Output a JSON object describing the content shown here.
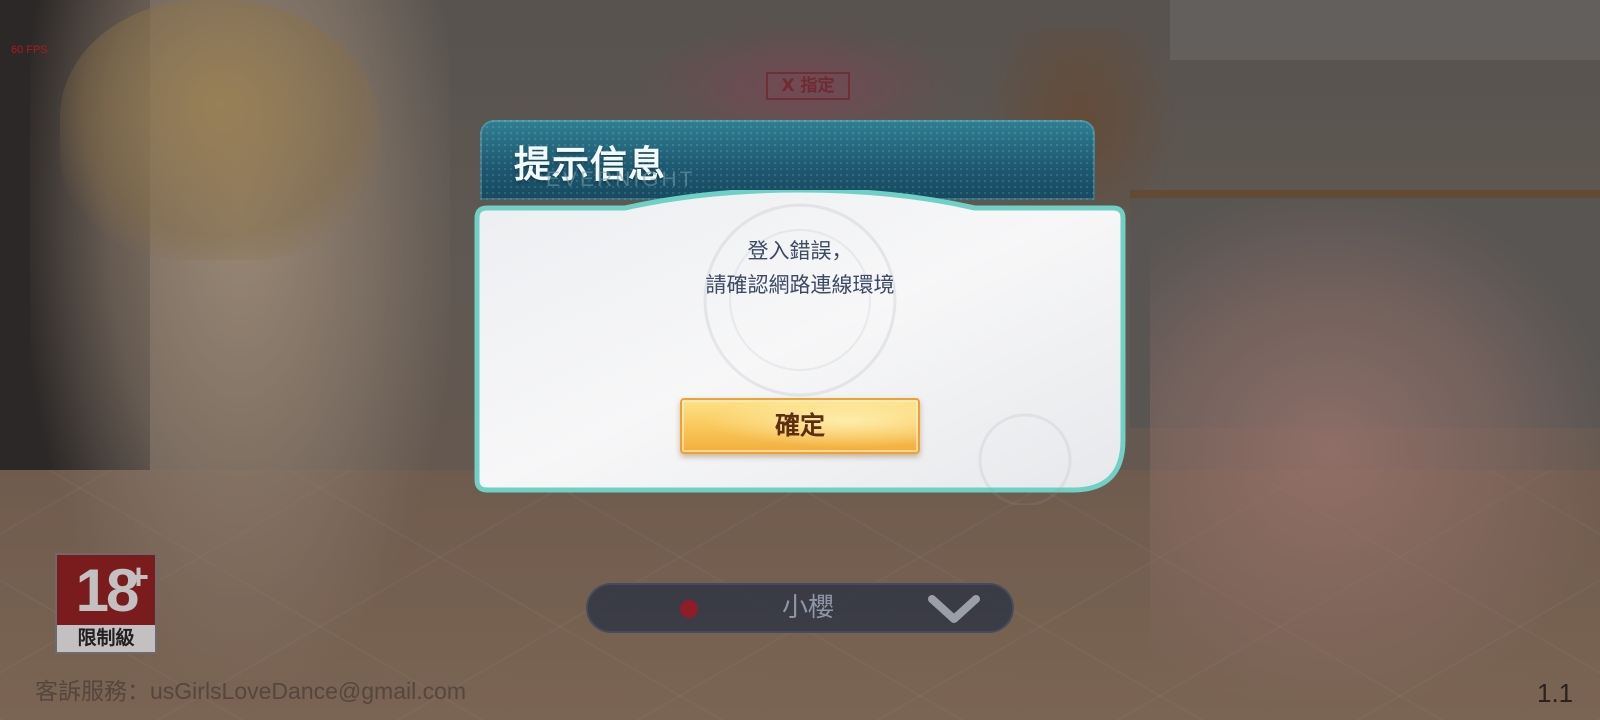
{
  "hud": {
    "fps": "60 FPS",
    "version": "1.1"
  },
  "game_logo": {
    "tag": "X 指定"
  },
  "rating": {
    "age": "18",
    "plus": "+",
    "label": "限制級"
  },
  "server": {
    "name": "小櫻",
    "status_color": "#b81c2e"
  },
  "contact": {
    "text": "客訴服務：usGirlsLoveDance@gmail.com"
  },
  "dialog": {
    "title": "提示信息",
    "title_watermark": "EVERNIGHT",
    "message_line1": "登入錯誤，",
    "message_line2": "請確認網路連線環境",
    "confirm_label": "確定"
  },
  "colors": {
    "header_teal": "#1d5870",
    "body_border": "#6fd0c6",
    "button_gold": "#f9c659",
    "text_navy": "#3c4a64"
  }
}
